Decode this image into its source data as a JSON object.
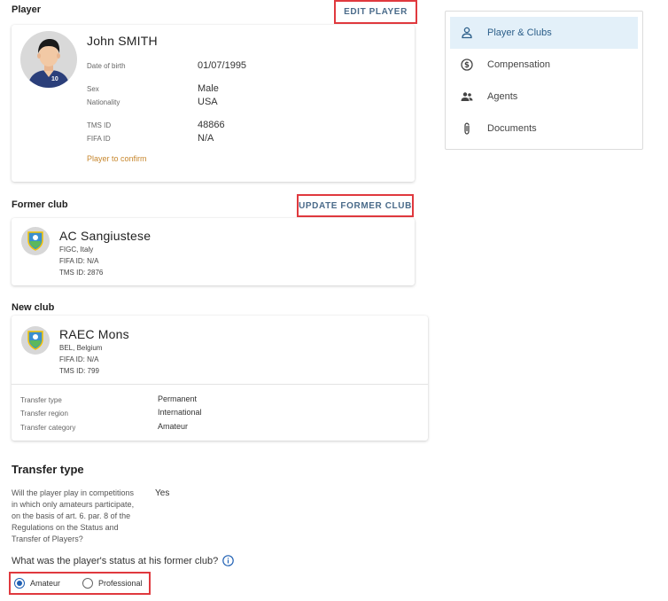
{
  "player_section": {
    "title": "Player",
    "edit_button": "EDIT PLAYER",
    "name": "John SMITH",
    "jersey_number": "10",
    "dob_label": "Date of birth",
    "dob_value": "01/07/1995",
    "sex_label": "Sex",
    "sex_value": "Male",
    "nationality_label": "Nationality",
    "nationality_value": "USA",
    "tms_label": "TMS ID",
    "tms_value": "48866",
    "fifa_label": "FIFA ID",
    "fifa_value": "N/A",
    "confirm_text": "Player to confirm"
  },
  "former_club": {
    "title": "Former club",
    "update_button": "UPDATE FORMER CLUB",
    "name": "AC Sangiustese",
    "assoc": "FIGC, Italy",
    "fifa_id": "FIFA ID: N/A",
    "tms_id": "TMS ID: 2876"
  },
  "new_club": {
    "title": "New club",
    "name": "RAEC Mons",
    "assoc": "BEL, Belgium",
    "fifa_id": "FIFA ID: N/A",
    "tms_id": "TMS ID: 799",
    "details": [
      {
        "label": "Transfer type",
        "value": "Permanent"
      },
      {
        "label": "Transfer region",
        "value": "International"
      },
      {
        "label": "Transfer category",
        "value": "Amateur"
      }
    ]
  },
  "transfer_type": {
    "heading": "Transfer type",
    "question_lines": [
      "Will the player play in competitions",
      "in which only amateurs participate,",
      "on the basis of art. 6. par. 8 of the",
      "Regulations on the Status and",
      "Transfer of Players?"
    ],
    "answer": "Yes",
    "status_question": "What was the player's status at his former club?",
    "options": [
      {
        "label": "Amateur",
        "selected": true
      },
      {
        "label": "Professional",
        "selected": false
      }
    ]
  },
  "side_nav": {
    "items": [
      {
        "label": "Player & Clubs",
        "icon": "person-icon",
        "active": true
      },
      {
        "label": "Compensation",
        "icon": "dollar-circle-icon",
        "active": false
      },
      {
        "label": "Agents",
        "icon": "people-icon",
        "active": false
      },
      {
        "label": "Documents",
        "icon": "paperclip-icon",
        "active": false
      }
    ]
  },
  "colors": {
    "accent": "#1e5fb3",
    "highlight_border": "#e0393e",
    "active_nav_bg": "#e3f0f9",
    "warning_text": "#c7872e"
  }
}
